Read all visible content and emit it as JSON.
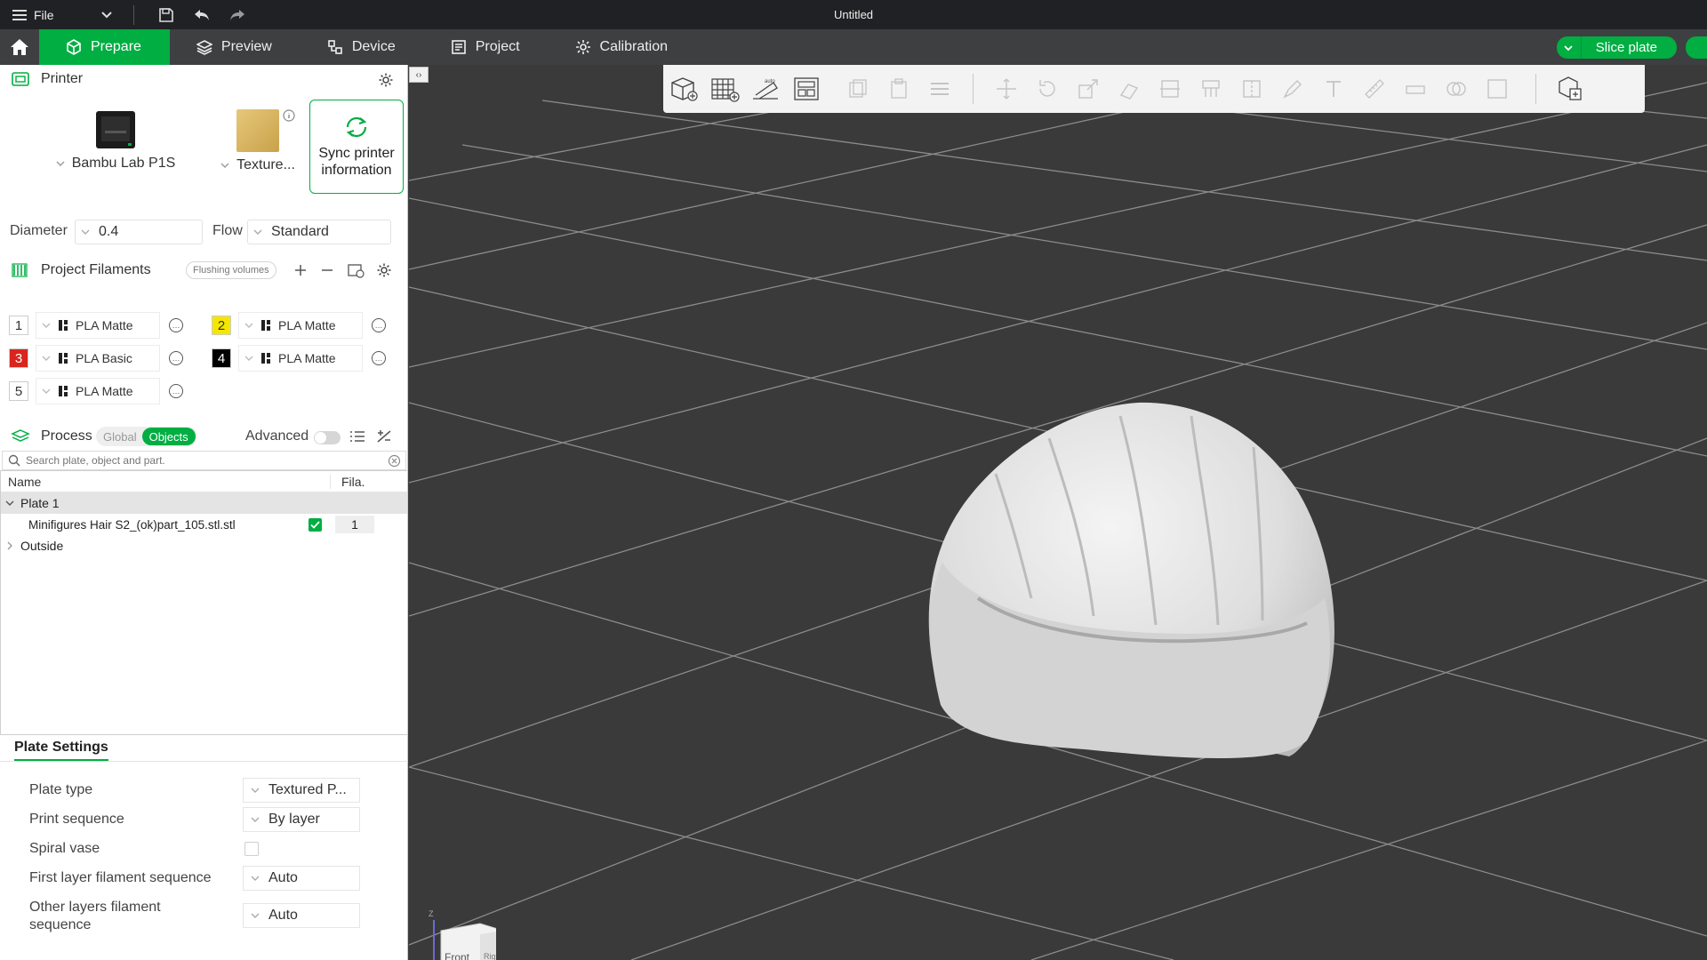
{
  "titlebar": {
    "file_label": "File",
    "title": "Untitled"
  },
  "tabs": [
    {
      "label": "Prepare"
    },
    {
      "label": "Preview"
    },
    {
      "label": "Device"
    },
    {
      "label": "Project"
    },
    {
      "label": "Calibration"
    }
  ],
  "slice_label": "Slice plate",
  "printer": {
    "section_title": "Printer",
    "printer_name": "Bambu Lab P1S",
    "plate_name": "Texture...",
    "sync_label_1": "Sync printer",
    "sync_label_2": "information",
    "diameter_label": "Diameter",
    "diameter_value": "0.4",
    "flow_label": "Flow",
    "flow_value": "Standard"
  },
  "filaments": {
    "section_title": "Project Filaments",
    "flushing_label": "Flushing volumes",
    "items": [
      {
        "num": "1",
        "name": "PLA Matte",
        "color": "#ffffff",
        "text_color": "#333333"
      },
      {
        "num": "2",
        "name": "PLA Matte",
        "color": "#f5e600",
        "text_color": "#333333"
      },
      {
        "num": "3",
        "name": "PLA Basic",
        "color": "#d8251d",
        "text_color": "#ffffff"
      },
      {
        "num": "4",
        "name": "PLA Matte",
        "color": "#000000",
        "text_color": "#ffffff"
      },
      {
        "num": "5",
        "name": "PLA Matte",
        "color": "#ffffff",
        "text_color": "#333333"
      }
    ]
  },
  "process": {
    "section_title": "Process",
    "global_label": "Global",
    "objects_label": "Objects",
    "advanced_label": "Advanced",
    "search_placeholder": "Search plate, object and part."
  },
  "tree": {
    "col_name": "Name",
    "col_fila": "Fila.",
    "plate_label": "Plate 1",
    "object_label": "Minifigures Hair S2_(ok)part_105.stl.stl",
    "object_fila": "1",
    "outside_label": "Outside"
  },
  "plate_settings": {
    "title": "Plate Settings",
    "plate_type_label": "Plate type",
    "plate_type_value": "Textured P...",
    "print_sequence_label": "Print sequence",
    "print_sequence_value": "By layer",
    "spiral_label": "Spiral vase",
    "first_layer_label": "First layer filament sequence",
    "first_layer_value": "Auto",
    "other_layers_label_1": "Other layers filament",
    "other_layers_label_2": "sequence",
    "other_layers_value": "Auto"
  },
  "navcube": {
    "z_label": "Z",
    "front_label": "Front",
    "right_label": "Right"
  },
  "colors": {
    "accent": "#00ae42",
    "viewport": "#3a3a3a",
    "titlebar": "#202124",
    "tabbar": "#3e3f41"
  }
}
